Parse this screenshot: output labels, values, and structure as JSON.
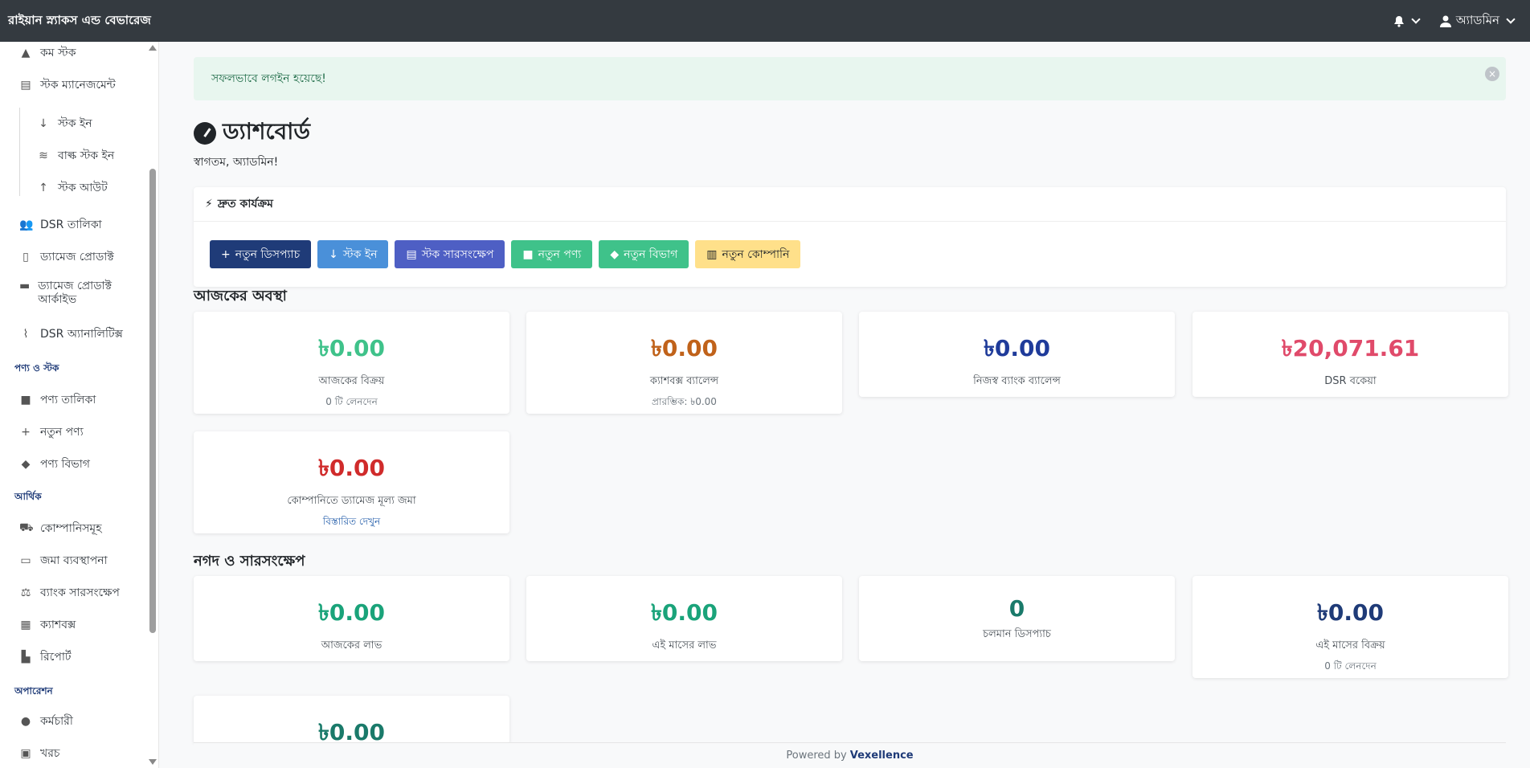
{
  "topbar": {
    "brand": "রাইয়ান স্ন্যাকস এন্ড বেভারেজ",
    "user_label": "অ্যাডমিন"
  },
  "sidebar": {
    "items": [
      {
        "label": "কম স্টক",
        "icon": "warning-icon"
      },
      {
        "label": "স্টক ম্যানেজমেন্ট",
        "icon": "warehouse-icon"
      },
      {
        "label": "স্টক ইন",
        "icon": "arrow-down-icon"
      },
      {
        "label": "বাল্ক স্টক ইন",
        "icon": "layers-icon"
      },
      {
        "label": "স্টক আউট",
        "icon": "arrow-up-icon"
      },
      {
        "label": "DSR তালিকা",
        "icon": "users-icon"
      },
      {
        "label": "ড্যামেজ প্রোডাক্ট",
        "icon": "file-icon"
      },
      {
        "label": "ড্যামেজ প্রোডাক্ট আর্কাইভ",
        "icon": "archive-icon"
      },
      {
        "label": "DSR অ্যানালিটিক্স",
        "icon": "chart-line-icon"
      },
      {
        "label": "পণ্য তালিকা",
        "icon": "box-icon"
      },
      {
        "label": "নতুন পণ্য",
        "icon": "plus-icon"
      },
      {
        "label": "পণ্য বিভাগ",
        "icon": "tags-icon"
      },
      {
        "label": "কোম্পানিসমূহ",
        "icon": "truck-icon"
      },
      {
        "label": "জমা ব্যবস্থাপনা",
        "icon": "card-icon"
      },
      {
        "label": "ব্যাংক সারসংক্ষেপ",
        "icon": "scale-icon"
      },
      {
        "label": "ক্যাশবক্স",
        "icon": "cash-register-icon"
      },
      {
        "label": "রিপোর্ট",
        "icon": "report-icon"
      },
      {
        "label": "কর্মচারী",
        "icon": "user-icon"
      },
      {
        "label": "খরচ",
        "icon": "money-icon"
      }
    ],
    "headings": {
      "products": "পণ্য ও স্টক",
      "finance": "আর্থিক",
      "operations": "অপারেশন"
    }
  },
  "alert": {
    "text": "সফলভাবে লগইন হয়েছে!"
  },
  "page": {
    "title": "ড্যাশবোর্ড",
    "welcome": "স্বাগতম, অ্যাডমিন!"
  },
  "quick_actions": {
    "title": "দ্রুত কার্যক্রম",
    "buttons": [
      {
        "label": "নতুন ডিসপ্যাচ",
        "color": "#1f3b78"
      },
      {
        "label": "স্টক ইন",
        "color": "#4a90d9"
      },
      {
        "label": "স্টক সারসংক্ষেপ",
        "color": "#4e5fc4"
      },
      {
        "label": "নতুন পণ্য",
        "color": "#3fc28a"
      },
      {
        "label": "নতুন বিভাগ",
        "color": "#3fc28a"
      },
      {
        "label": "নতুন কোম্পানি",
        "color": "#ffe08a"
      }
    ]
  },
  "today": {
    "title": "আজকের অবস্থা",
    "cards": [
      {
        "value": "৳0.00",
        "label": "আজকের বিক্রয়",
        "sub": "0 টি লেনদেন",
        "color": "#3fc28a"
      },
      {
        "value": "৳0.00",
        "label": "ক্যাশবক্স ব্যালেন্স",
        "sub": "প্রারম্ভিক: ৳0.00",
        "color": "#c0621a"
      },
      {
        "value": "৳0.00",
        "label": "নিজস্ব ব্যাংক ব্যালেন্স",
        "sub": "",
        "color": "#1f3b9a"
      },
      {
        "value": "৳20,071.61",
        "label": "DSR বকেয়া",
        "sub": "",
        "color": "#e04a6a"
      },
      {
        "value": "৳0.00",
        "label": "কোম্পানিতে ড্যামেজ মূল্য জমা",
        "link": "বিস্তারিত দেখুন",
        "color": "#d02b2b"
      }
    ]
  },
  "cash": {
    "title": "নগদ ও সারসংক্ষেপ",
    "cards": [
      {
        "value": "৳0.00",
        "label": "আজকের লাভ",
        "sub": "",
        "color": "#1aa37a"
      },
      {
        "value": "৳0.00",
        "label": "এই মাসের লাভ",
        "sub": "",
        "color": "#1aa37a"
      },
      {
        "value": "0",
        "label": "চলমান ডিসপ্যাচ",
        "sub": "",
        "color": "#1a7a6a"
      },
      {
        "value": "৳0.00",
        "label": "এই মাসের বিক্রয়",
        "sub": "0 টি লেনদেন",
        "color": "#1f3b78"
      },
      {
        "value": "৳0.00",
        "label": "",
        "sub": "",
        "color": "#1a7a6a"
      }
    ]
  },
  "footer": {
    "prefix": "Powered by",
    "brand": "Vexellence"
  }
}
